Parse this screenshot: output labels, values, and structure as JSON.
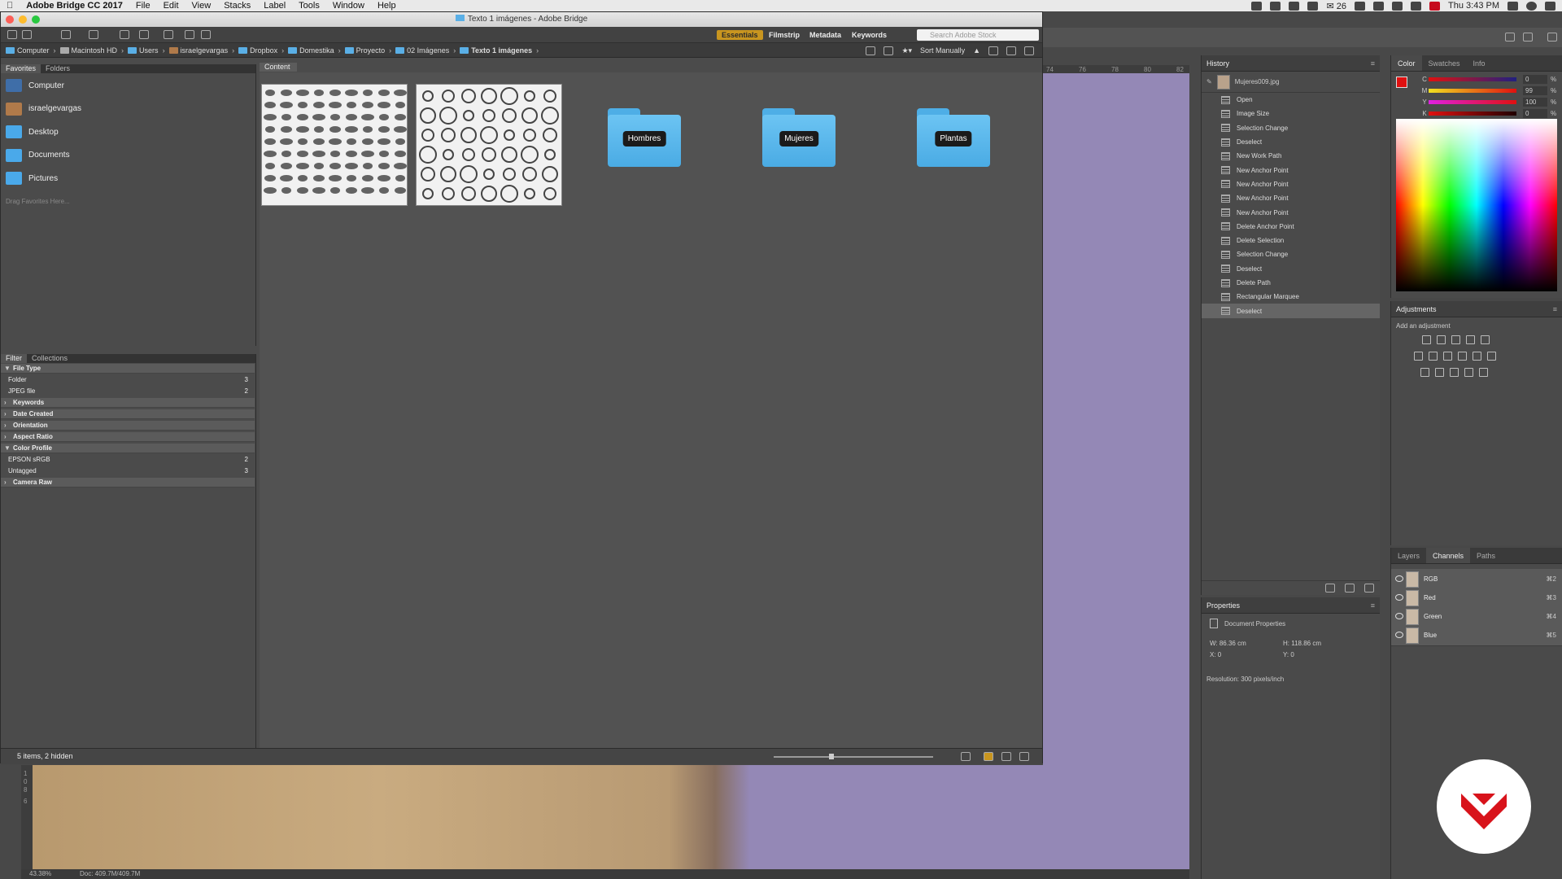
{
  "menubar": {
    "app_name": "Adobe Bridge CC 2017",
    "items": [
      "File",
      "Edit",
      "View",
      "Stacks",
      "Label",
      "Tools",
      "Window",
      "Help"
    ],
    "mail_count": "26",
    "clock": "Thu 3:43 PM"
  },
  "bridge": {
    "title": "Texto 1 imágenes - Adobe Bridge",
    "workspaces": [
      "Essentials",
      "Filmstrip",
      "Metadata",
      "Keywords"
    ],
    "stock_search_placeholder": "Search Adobe Stock",
    "breadcrumbs": [
      "Computer",
      "Macintosh HD",
      "Users",
      "israelgevargas",
      "Dropbox",
      "Domestika",
      "Proyecto",
      "02 Imágenes",
      "Texto 1 imágenes"
    ],
    "sort_label": "Sort Manually",
    "favorites_tabs": [
      "Favorites",
      "Folders"
    ],
    "favorites": [
      {
        "label": "Computer",
        "icon": "computer-icon"
      },
      {
        "label": "israelgevargas",
        "icon": "home-icon"
      },
      {
        "label": "Desktop",
        "icon": "folder-icon"
      },
      {
        "label": "Documents",
        "icon": "folder-icon"
      },
      {
        "label": "Pictures",
        "icon": "folder-icon"
      }
    ],
    "favorites_drop_hint": "Drag Favorites Here...",
    "filter_tabs": [
      "Filter",
      "Collections"
    ],
    "filters": [
      {
        "label": "File Type",
        "kind": "category",
        "expanded": true
      },
      {
        "label": "Folder",
        "count": "3"
      },
      {
        "label": "JPEG file",
        "count": "2"
      },
      {
        "label": "Keywords",
        "kind": "category"
      },
      {
        "label": "Date Created",
        "kind": "category"
      },
      {
        "label": "Orientation",
        "kind": "category"
      },
      {
        "label": "Aspect Ratio",
        "kind": "category"
      },
      {
        "label": "Color Profile",
        "kind": "category",
        "expanded": true
      },
      {
        "label": "EPSON  sRGB",
        "count": "2"
      },
      {
        "label": "Untagged",
        "count": "3"
      },
      {
        "label": "Camera Raw",
        "kind": "category"
      }
    ],
    "content_tab": "Content",
    "folders": [
      "Hombres",
      "Mujeres",
      "Plantas"
    ],
    "status": "5 items, 2 hidden"
  },
  "photoshop": {
    "ruler_top": [
      "74",
      "76",
      "78",
      "80",
      "82"
    ],
    "ruler_left": [
      "1",
      "0",
      "8",
      "6"
    ],
    "zoom": "43.38%",
    "doc_size": "Doc: 409.7M/409.7M",
    "history": {
      "title": "History",
      "snapshot": "Mujeres009.jpg",
      "steps": [
        "Open",
        "Image Size",
        "Selection Change",
        "Deselect",
        "New Work Path",
        "New Anchor Point",
        "New Anchor Point",
        "New Anchor Point",
        "New Anchor Point",
        "Delete Anchor Point",
        "Delete Selection",
        "Selection Change",
        "Deselect",
        "Delete Path",
        "Rectangular Marquee",
        "Deselect"
      ],
      "selected_index": 15
    },
    "properties": {
      "title": "Properties",
      "subtitle": "Document Properties",
      "w": "W: 86.36 cm",
      "h": "H: 118.86 cm",
      "x": "X: 0",
      "y": "Y: 0",
      "resolution": "Resolution: 300 pixels/inch"
    },
    "color": {
      "tabs": [
        "Color",
        "Swatches",
        "Info"
      ],
      "sliders": [
        {
          "label": "C",
          "value": "0"
        },
        {
          "label": "M",
          "value": "99"
        },
        {
          "label": "Y",
          "value": "100"
        },
        {
          "label": "K",
          "value": "0"
        }
      ],
      "foreground": "#e01010",
      "background": "#ffffff"
    },
    "adjustments": {
      "title": "Adjustments",
      "hint": "Add an adjustment"
    },
    "channels": {
      "tabs": [
        "Layers",
        "Channels",
        "Paths"
      ],
      "rows": [
        {
          "name": "RGB",
          "shortcut": "⌘2"
        },
        {
          "name": "Red",
          "shortcut": "⌘3"
        },
        {
          "name": "Green",
          "shortcut": "⌘4"
        },
        {
          "name": "Blue",
          "shortcut": "⌘5"
        }
      ]
    }
  }
}
